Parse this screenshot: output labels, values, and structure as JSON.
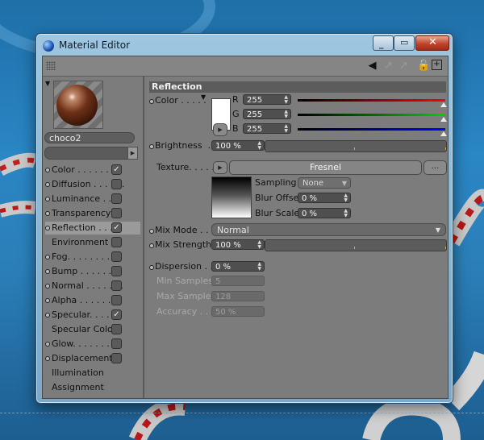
{
  "window": {
    "title": "Material Editor"
  },
  "material": {
    "name": "choco2"
  },
  "channels": [
    {
      "label": "Color . . . . . . . .",
      "checked": true,
      "checkbox": true,
      "dot": true
    },
    {
      "label": "Diffusion . . . . . .",
      "checked": false,
      "checkbox": true,
      "dot": true
    },
    {
      "label": "Luminance . . . .",
      "checked": false,
      "checkbox": true,
      "dot": true
    },
    {
      "label": "Transparency",
      "checked": false,
      "checkbox": true,
      "dot": true
    },
    {
      "label": "Reflection . . . .",
      "checked": true,
      "checkbox": true,
      "dot": true,
      "selected": true
    },
    {
      "label": "Environment",
      "checked": false,
      "checkbox": true,
      "dot": false
    },
    {
      "label": "Fog. . . . . . . . .",
      "checked": false,
      "checkbox": true,
      "dot": true
    },
    {
      "label": "Bump . . . . . . . .",
      "checked": false,
      "checkbox": true,
      "dot": true
    },
    {
      "label": "Normal . . . . . . .",
      "checked": false,
      "checkbox": true,
      "dot": true
    },
    {
      "label": "Alpha . . . . . . . .",
      "checked": false,
      "checkbox": true,
      "dot": true
    },
    {
      "label": "Specular. . . . . .",
      "checked": true,
      "checkbox": true,
      "dot": true
    },
    {
      "label": "Specular Color",
      "checked": false,
      "checkbox": true,
      "dot": false
    },
    {
      "label": "Glow. . . . . . . . .",
      "checked": false,
      "checkbox": true,
      "dot": true
    },
    {
      "label": "Displacement",
      "checked": false,
      "checkbox": true,
      "dot": true
    },
    {
      "label": "Illumination",
      "checked": false,
      "checkbox": false,
      "dot": false
    },
    {
      "label": "Assignment",
      "checked": false,
      "checkbox": false,
      "dot": false
    }
  ],
  "reflection": {
    "header": "Reflection",
    "color_label": "Color . . . . .",
    "r_label": "R",
    "r_value": "255",
    "g_label": "G",
    "g_value": "255",
    "b_label": "B",
    "b_value": "255",
    "swatch_color": "#ffffff",
    "brightness_label": "Brightness  . .",
    "brightness_value": "100 %",
    "brightness_fraction": 0.5,
    "texture_label": "Texture. . . . . .",
    "texture_name": "Fresnel",
    "texture_more": "...",
    "sampling_label": "Sampling",
    "sampling_value": "None",
    "blur_offset_label": "Blur Offset",
    "blur_offset_value": "0 %",
    "blur_scale_label": "Blur Scale",
    "blur_scale_value": "0 %",
    "mix_mode_label": "Mix Mode . . . .",
    "mix_mode_value": "Normal",
    "mix_strength_label": "Mix Strength",
    "mix_strength_value": "100 %",
    "dispersion_label": "Dispersion . . .",
    "dispersion_value": "0 %",
    "min_samples_label": "Min Samples",
    "min_samples_value": "5",
    "max_samples_label": "Max Samples",
    "max_samples_value": "128",
    "accuracy_label": "Accuracy . . . .",
    "accuracy_value": "50 %"
  }
}
